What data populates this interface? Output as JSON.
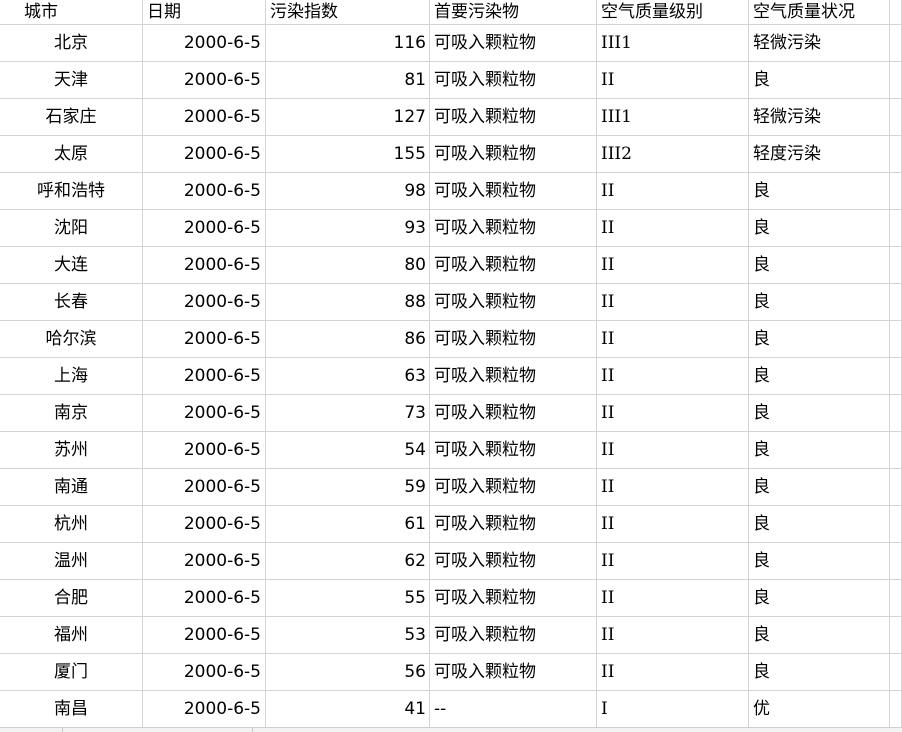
{
  "headers": {
    "city": "城市",
    "date": "日期",
    "index": "污染指数",
    "pollutant": "首要污染物",
    "grade": "空气质量级别",
    "status": "空气质量状况"
  },
  "rows": [
    {
      "city": "北京",
      "date": "2000-6-5",
      "index": "116",
      "pollutant": "可吸入颗粒物",
      "grade": "III1",
      "status": "轻微污染"
    },
    {
      "city": "天津",
      "date": "2000-6-5",
      "index": "81",
      "pollutant": "可吸入颗粒物",
      "grade": "II",
      "status": "良"
    },
    {
      "city": "石家庄",
      "date": "2000-6-5",
      "index": "127",
      "pollutant": "可吸入颗粒物",
      "grade": "III1",
      "status": "轻微污染"
    },
    {
      "city": "太原",
      "date": "2000-6-5",
      "index": "155",
      "pollutant": "可吸入颗粒物",
      "grade": "III2",
      "status": "轻度污染"
    },
    {
      "city": "呼和浩特",
      "date": "2000-6-5",
      "index": "98",
      "pollutant": "可吸入颗粒物",
      "grade": "II",
      "status": "良"
    },
    {
      "city": "沈阳",
      "date": "2000-6-5",
      "index": "93",
      "pollutant": "可吸入颗粒物",
      "grade": "II",
      "status": "良"
    },
    {
      "city": "大连",
      "date": "2000-6-5",
      "index": "80",
      "pollutant": "可吸入颗粒物",
      "grade": "II",
      "status": "良"
    },
    {
      "city": "长春",
      "date": "2000-6-5",
      "index": "88",
      "pollutant": "可吸入颗粒物",
      "grade": "II",
      "status": "良"
    },
    {
      "city": "哈尔滨",
      "date": "2000-6-5",
      "index": "86",
      "pollutant": "可吸入颗粒物",
      "grade": "II",
      "status": "良"
    },
    {
      "city": "上海",
      "date": "2000-6-5",
      "index": "63",
      "pollutant": "可吸入颗粒物",
      "grade": "II",
      "status": "良"
    },
    {
      "city": "南京",
      "date": "2000-6-5",
      "index": "73",
      "pollutant": "可吸入颗粒物",
      "grade": "II",
      "status": "良"
    },
    {
      "city": "苏州",
      "date": "2000-6-5",
      "index": "54",
      "pollutant": "可吸入颗粒物",
      "grade": "II",
      "status": "良"
    },
    {
      "city": "南通",
      "date": "2000-6-5",
      "index": "59",
      "pollutant": "可吸入颗粒物",
      "grade": "II",
      "status": "良"
    },
    {
      "city": "杭州",
      "date": "2000-6-5",
      "index": "61",
      "pollutant": "可吸入颗粒物",
      "grade": "II",
      "status": "良"
    },
    {
      "city": "温州",
      "date": "2000-6-5",
      "index": "62",
      "pollutant": "可吸入颗粒物",
      "grade": "II",
      "status": "良"
    },
    {
      "city": "合肥",
      "date": "2000-6-5",
      "index": "55",
      "pollutant": "可吸入颗粒物",
      "grade": "II",
      "status": "良"
    },
    {
      "city": "福州",
      "date": "2000-6-5",
      "index": "53",
      "pollutant": "可吸入颗粒物",
      "grade": "II",
      "status": "良"
    },
    {
      "city": "厦门",
      "date": "2000-6-5",
      "index": "56",
      "pollutant": "可吸入颗粒物",
      "grade": "II",
      "status": "良"
    },
    {
      "city": "南昌",
      "date": "2000-6-5",
      "index": "41",
      "pollutant": "--",
      "grade": "I",
      "status": "优"
    }
  ]
}
